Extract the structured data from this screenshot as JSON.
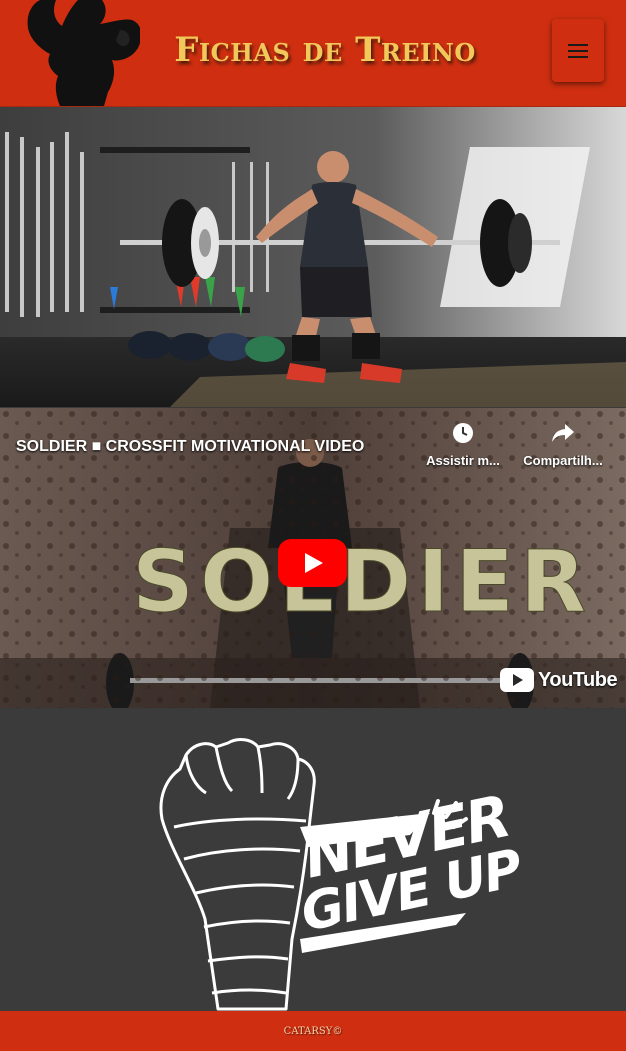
{
  "header": {
    "title": "Fichas de Treino",
    "logo_icon": "bodybuilder-silhouette-icon",
    "menu_icon": "hamburger-menu-icon"
  },
  "hero": {
    "image": "crossfit-barbell-lift-photo"
  },
  "video": {
    "title": "SOLDIER ■ CROSSFIT MOTIVATIONAL VIDEO",
    "watch_later_label": "Assistir m...",
    "share_label": "Compartilh...",
    "overlay_word": "SOLDIER",
    "brand": "YouTube"
  },
  "poster": {
    "line1": "NEVER",
    "line2": "GIVE UP"
  },
  "footer": {
    "text": "CATARSY©"
  },
  "colors": {
    "primary": "#cf2f10",
    "title_gold": "#f3c85a",
    "background": "#3a3a3a"
  }
}
